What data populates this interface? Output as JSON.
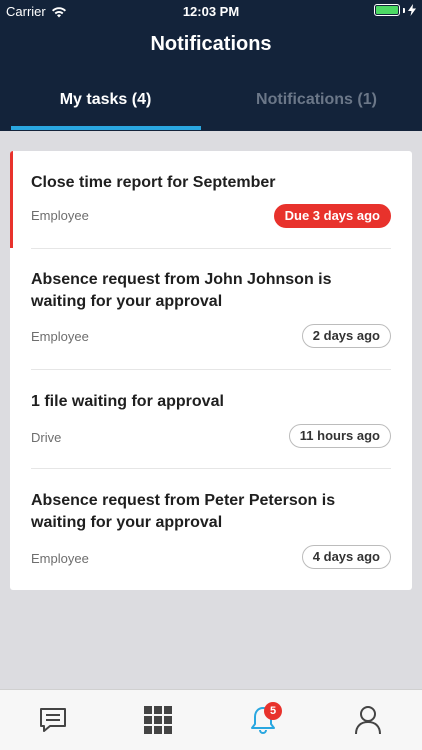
{
  "status_bar": {
    "carrier": "Carrier",
    "time": "12:03 PM"
  },
  "header": {
    "title": "Notifications"
  },
  "tabs": [
    {
      "label": "My tasks (4)",
      "active": true
    },
    {
      "label": "Notifications (1)",
      "active": false
    }
  ],
  "tasks": [
    {
      "title": "Close time report for September",
      "source": "Employee",
      "badge": "Due 3 days ago",
      "overdue": true
    },
    {
      "title": "Absence request from John Johnson is waiting for your approval",
      "source": "Employee",
      "badge": "2 days ago",
      "overdue": false
    },
    {
      "title": "1 file waiting for approval",
      "source": "Drive",
      "badge": "11 hours ago",
      "overdue": false
    },
    {
      "title": "Absence request from Peter Peterson is waiting for your approval",
      "source": "Employee",
      "badge": "4 days ago",
      "overdue": false
    }
  ],
  "tab_bar": {
    "items": [
      {
        "icon": "chat-icon",
        "label": ""
      },
      {
        "icon": "apps-grid-icon",
        "label": ""
      },
      {
        "icon": "bell-icon",
        "label": ""
      },
      {
        "icon": "profile-icon",
        "label": ""
      }
    ],
    "notification_badge": "5"
  },
  "colors": {
    "header_bg": "#13233a",
    "accent_blue": "#2aa7e0",
    "overdue_red": "#e8322c"
  }
}
